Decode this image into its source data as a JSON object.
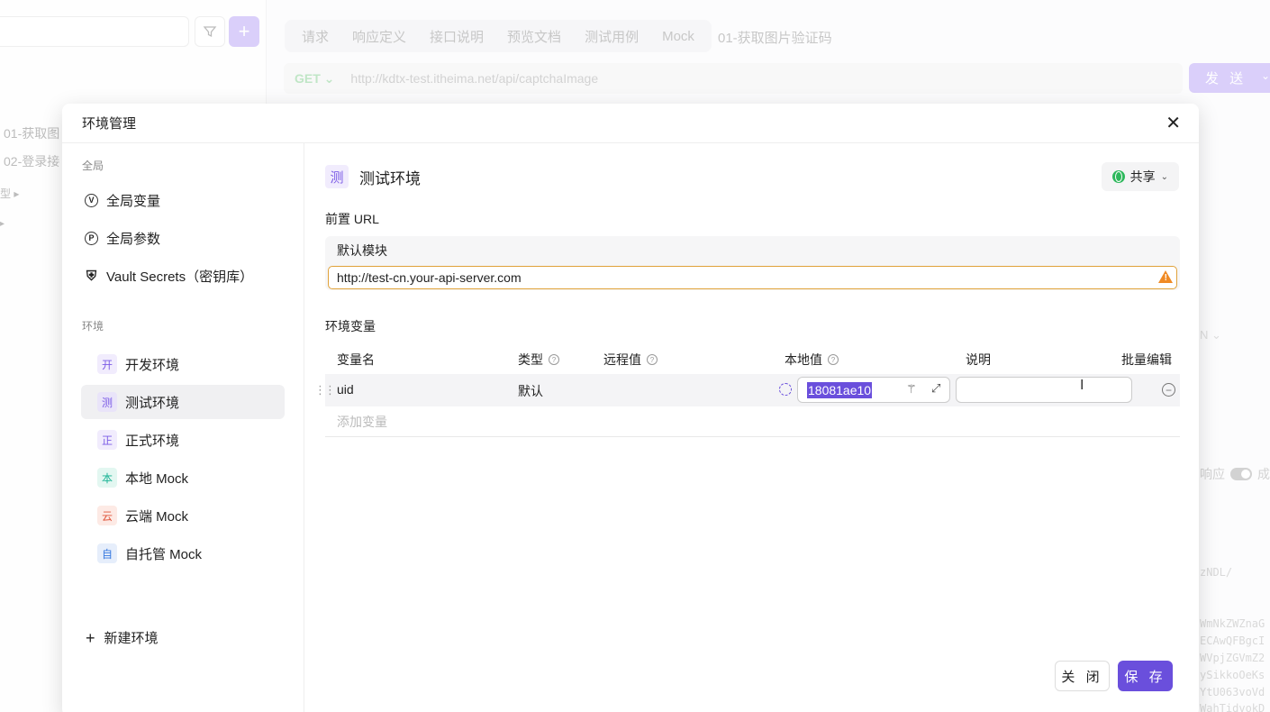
{
  "background": {
    "tree": [
      "01-获取图",
      "02-登录接",
      "型 ▸",
      "▸"
    ],
    "tabs": [
      "请求",
      "响应定义",
      "接口说明",
      "预览文档",
      "测试用例",
      "Mock"
    ],
    "tab_title": "01-获取图片验证码",
    "method": "GET ⌄",
    "url": "http://kdtx-test.itheima.net/api/captchaImage",
    "send_label": "发 送",
    "response_label": "响应",
    "response_extra": "成",
    "code_lines": [
      "zNDL/",
      "WmNkZWZnaG",
      "ECAwQFBgcI",
      "WVpjZGVmZ2",
      "ySikkoOeKs",
      "YtU063voVd",
      "WahTidvokD"
    ],
    "ghost_fields": [
      "N ⌄"
    ]
  },
  "modal": {
    "title": "环境管理",
    "close_symbol": "✕",
    "sidebar": {
      "global_section": "全局",
      "global_items": [
        {
          "label": "全局变量",
          "icon": "V"
        },
        {
          "label": "全局参数",
          "icon": "P"
        },
        {
          "label": "Vault Secrets（密钥库）",
          "icon": "⛨"
        }
      ],
      "env_section": "环境",
      "envs": [
        {
          "badge": "开",
          "label": "开发环境",
          "color": "#7c5ce6",
          "bg": "#f1ecfd"
        },
        {
          "badge": "测",
          "label": "测试环境",
          "color": "#7c5ce6",
          "bg": "#e9e4f9"
        },
        {
          "badge": "正",
          "label": "正式环境",
          "color": "#7c5ce6",
          "bg": "#f1ecfd"
        },
        {
          "badge": "本",
          "label": "本地 Mock",
          "color": "#19b394",
          "bg": "#e3f7f1"
        },
        {
          "badge": "云",
          "label": "云端 Mock",
          "color": "#e0563c",
          "bg": "#fdeae5"
        },
        {
          "badge": "自",
          "label": "自托管 Mock",
          "color": "#3a7be0",
          "bg": "#e6eefb"
        }
      ],
      "new_env": "新建环境"
    },
    "env": {
      "badge": "测",
      "name": "测试环境",
      "share_label": "共享",
      "prefix_url_label": "前置 URL",
      "module_label": "默认模块",
      "module_url": "http://test-cn.your-api-server.com",
      "vars_label": "环境变量",
      "columns": {
        "name": "变量名",
        "type": "类型",
        "remote": "远程值",
        "local": "本地值",
        "desc": "说明",
        "bulk": "批量编辑"
      },
      "rows": [
        {
          "name": "uid",
          "type": "默认",
          "remote": "",
          "local": "18081ae10",
          "desc": ""
        }
      ],
      "add_var_placeholder": "添加变量"
    },
    "footer": {
      "close_label": "关 闭",
      "save_label": "保 存"
    },
    "colors": {
      "accent": "#6a4fdc",
      "warning": "#f08a24",
      "share_globe": "#2eb85c"
    }
  }
}
